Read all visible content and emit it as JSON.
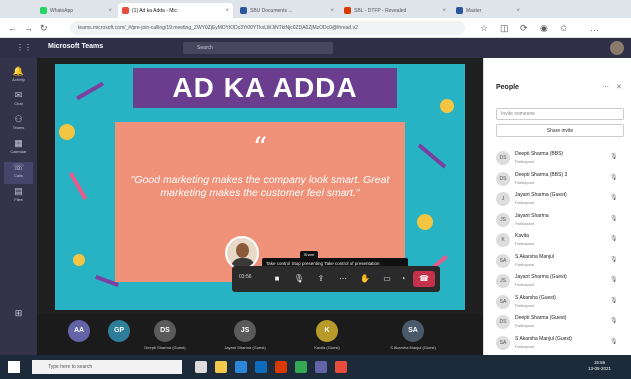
{
  "browser": {
    "tabs": [
      {
        "label": "WhatsApp",
        "color": "#25d366",
        "active": false
      },
      {
        "label": "(1) Ad ka Adda - Mic",
        "color": "#e74c3c",
        "active": true
      },
      {
        "label": "SBU Documents ...",
        "color": "#2b579a",
        "active": false
      },
      {
        "label": "SBL - DTFP - Revealed",
        "color": "#d83b01",
        "active": false
      },
      {
        "label": "Master",
        "color": "#2b579a",
        "active": false
      }
    ],
    "url": "teams.microsoft.com/_#/pre-join-calling/19:meeting_ZWY0ZjEyMDYtODc3Yi00YTkxLWJiNTktNjc0ZDA0ZjMzODc0@thread.v2"
  },
  "teams": {
    "title": "Microsoft Teams",
    "search_placeholder": "Search"
  },
  "rail": [
    {
      "label": "Activity",
      "icon": "bell-icon"
    },
    {
      "label": "Chat",
      "icon": "chat-icon"
    },
    {
      "label": "Teams",
      "icon": "teams-icon"
    },
    {
      "label": "Calendar",
      "icon": "calendar-icon"
    },
    {
      "label": "Calls",
      "icon": "phone-icon"
    },
    {
      "label": "Files",
      "icon": "file-icon"
    }
  ],
  "slide": {
    "title": "AD KA ADDA",
    "quote_mark": "“",
    "quote": "\"Good marketing makes the company look smart. Great marketing makes the customer feel smart.\""
  },
  "controls": {
    "time": "03:56",
    "tooltip": "Take control  Stop presenting  Take control of presentation",
    "tooltip_small": "Share"
  },
  "strip": [
    {
      "initials": "AA",
      "name": "",
      "color": "#6264a7"
    },
    {
      "initials": "GP",
      "name": "",
      "color": "#2e7d9a"
    },
    {
      "initials": "DS",
      "name": "Deepti Sharma (Guest)",
      "color": "#5a5a5a"
    },
    {
      "initials": "JS",
      "name": "Jayant Sharma (Guest)",
      "color": "#5a5a5a"
    },
    {
      "initials": "K",
      "name": "Kavita (Guest)",
      "color": "#b89a2a"
    },
    {
      "initials": "SA",
      "name": "S Akarsha Manjul (Guest)",
      "color": "#4a5a6a"
    }
  ],
  "people": {
    "title": "People",
    "search_placeholder": "Invite someone",
    "share_invite": "Share invite",
    "list": [
      {
        "initials": "DS",
        "name": "Deepti Sharma (BBS)",
        "role": "Participant"
      },
      {
        "initials": "DS",
        "name": "Deepti Sharma (BBS) 3",
        "role": "Participant"
      },
      {
        "initials": "J",
        "name": "Jayant Sharma (Guest)",
        "role": "Participant"
      },
      {
        "initials": "JS",
        "name": "Jayant Sharma",
        "role": "Participant"
      },
      {
        "initials": "K",
        "name": "Kavita",
        "role": "Participant"
      },
      {
        "initials": "SA",
        "name": "S Akarsha Manjul",
        "role": "Participant"
      },
      {
        "initials": "JS",
        "name": "Jayant Sharma (Guest)",
        "role": "Participant"
      },
      {
        "initials": "SA",
        "name": "S Akarsha (Guest)",
        "role": "Participant"
      },
      {
        "initials": "DS",
        "name": "Deepti Sharma (Guest)",
        "role": "Participant"
      },
      {
        "initials": "SA",
        "name": "S Akarsha Manjul (Guest)",
        "role": "Participant"
      }
    ]
  },
  "taskbar": {
    "search_placeholder": "Type here to search",
    "time": "15:56",
    "date": "13-05-2021"
  }
}
